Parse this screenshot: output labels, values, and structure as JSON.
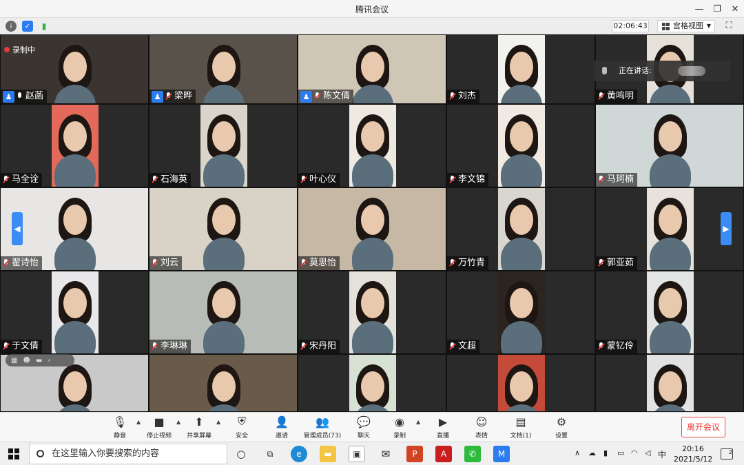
{
  "app": {
    "title": "腾讯会议"
  },
  "infobar": {
    "timer": "02:06:43",
    "view_mode": "宫格视图"
  },
  "recording": {
    "label": "录制中"
  },
  "speaking": {
    "label": "正在讲话:"
  },
  "participants": [
    {
      "name": "赵菡",
      "host": true,
      "muted": false
    },
    {
      "name": "梁晔",
      "host": true,
      "muted": true
    },
    {
      "name": "陈文倩",
      "host": true,
      "muted": true
    },
    {
      "name": "刘杰",
      "host": false,
      "muted": true
    },
    {
      "name": "黄鸣明",
      "host": false,
      "muted": true
    },
    {
      "name": "马全诠",
      "host": false,
      "muted": true
    },
    {
      "name": "石海英",
      "host": false,
      "muted": true
    },
    {
      "name": "叶心仪",
      "host": false,
      "muted": true
    },
    {
      "name": "李文锦",
      "host": false,
      "muted": true
    },
    {
      "name": "马珂楠",
      "host": false,
      "muted": true
    },
    {
      "name": "翟诗怡",
      "host": false,
      "muted": true
    },
    {
      "name": "刘云",
      "host": false,
      "muted": true
    },
    {
      "name": "莫思怡",
      "host": false,
      "muted": true
    },
    {
      "name": "万竹青",
      "host": false,
      "muted": true
    },
    {
      "name": "郭亚茹",
      "host": false,
      "muted": true
    },
    {
      "name": "于文倩",
      "host": false,
      "muted": true
    },
    {
      "name": "李琳琳",
      "host": false,
      "muted": true
    },
    {
      "name": "宋丹阳",
      "host": false,
      "muted": true
    },
    {
      "name": "文超",
      "host": false,
      "muted": true
    },
    {
      "name": "蒙钇伶",
      "host": false,
      "muted": true
    },
    {
      "name": "",
      "host": false,
      "muted": false
    },
    {
      "name": "",
      "host": false,
      "muted": false
    },
    {
      "name": "",
      "host": false,
      "muted": false
    },
    {
      "name": "",
      "host": false,
      "muted": false
    },
    {
      "name": "",
      "host": false,
      "muted": false
    }
  ],
  "toolbar": {
    "mute": "静音",
    "stop_video": "停止视频",
    "share_screen": "共享屏幕",
    "security": "安全",
    "invite": "邀请",
    "manage_members": "管理成员(73)",
    "chat": "聊天",
    "record": "录制",
    "live": "直播",
    "reactions": "表情",
    "documents": "文档(1)",
    "settings": "设置",
    "leave": "离开会议"
  },
  "taskbar": {
    "search_placeholder": "在这里输入你要搜索的内容",
    "ime": "中",
    "time": "20:16",
    "date": "2021/5/12",
    "notifications": "2"
  },
  "colors": {
    "accent": "#2d7bf0",
    "leave": "#e33333",
    "recording": "#e23b3b"
  }
}
